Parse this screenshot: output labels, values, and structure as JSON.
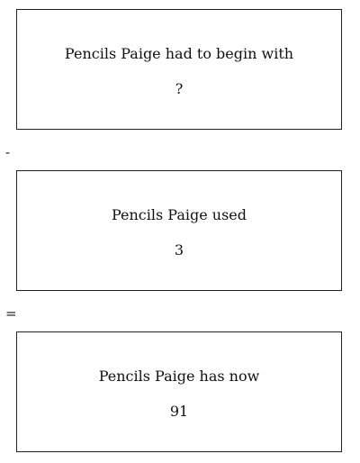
{
  "boxes": [
    {
      "label": "Pencils Paige had to begin with",
      "value": "?"
    },
    {
      "label": "Pencils Paige used",
      "value": "3"
    },
    {
      "label": "Pencils Paige has now",
      "value": "91"
    }
  ],
  "operators": {
    "minus": "-",
    "equals": "="
  }
}
